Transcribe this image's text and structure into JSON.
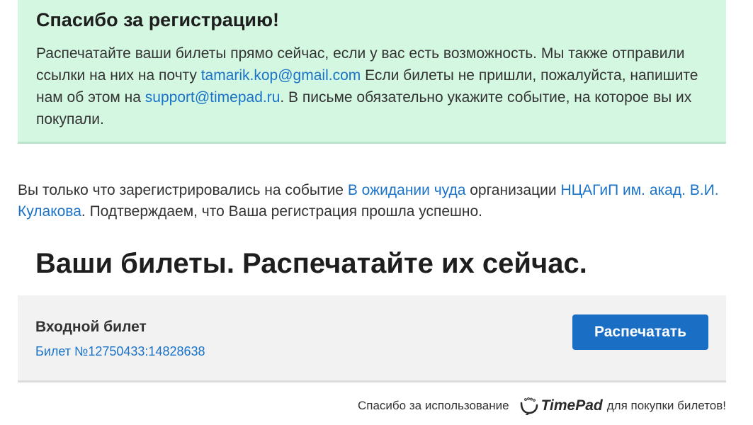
{
  "notice": {
    "title": "Спасибо за регистрацию!",
    "text_1": "Распечатайте ваши билеты прямо сейчас, если у вас есть возможность. Мы также отправили ссылки на них на почту ",
    "email": "tamarik.kop@gmail.com",
    "text_2": " Если билеты не пришли, пожалуйста, напишите нам об этом на ",
    "support_email": "support@timepad.ru",
    "text_3": ". В письме обязательно укажите событие, на которое вы их покупали."
  },
  "registration": {
    "text_1": "Вы только что зарегистрировались на событие ",
    "event_link": "В ожидании чуда",
    "text_2": " организации ",
    "org_link": "НЦАГиП им. акад. В.И. Кулакова",
    "text_3": ". Подтверждаем, что Ваша регистрация прошла успешно."
  },
  "tickets": {
    "title": "Ваши билеты. Распечатайте их сейчас.",
    "items": [
      {
        "type": "Входной билет",
        "number": "Билет №12750433:14828638",
        "print_label": "Распечатать"
      }
    ]
  },
  "footer": {
    "text_before": "Спасибо за использование",
    "brand": "TimePad",
    "brand_icon": "timepad-logo-icon",
    "text_after": "для покупки билетов!"
  }
}
